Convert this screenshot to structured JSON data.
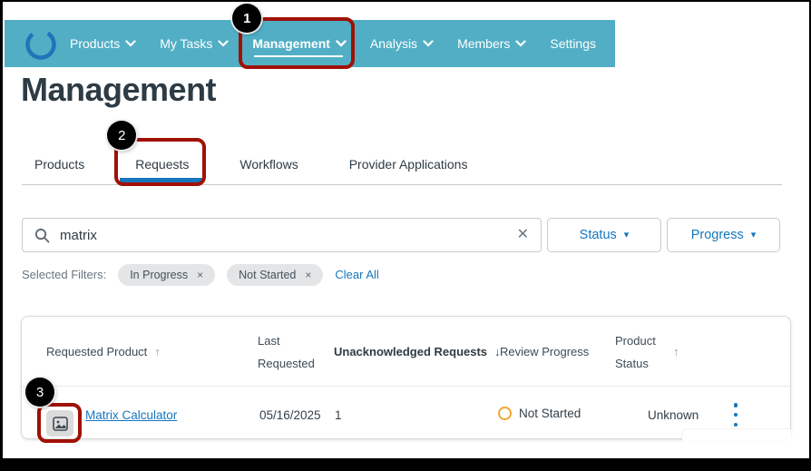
{
  "colors": {
    "navbar_teal": "#51AEC5",
    "accent_blue": "#1577BD",
    "heading_dark": "#2D3B45",
    "highlight_red": "#A01005",
    "status_amber": "#EFA92C",
    "callout_black": "#000000"
  },
  "navbar": {
    "items": [
      {
        "label": "Products",
        "chevron": true
      },
      {
        "label": "My Tasks",
        "chevron": true
      },
      {
        "label": "Management",
        "chevron": true,
        "active": true
      },
      {
        "label": "Analysis",
        "chevron": true
      },
      {
        "label": "Members",
        "chevron": true
      },
      {
        "label": "Settings",
        "chevron": false
      }
    ]
  },
  "page": {
    "title": "Management"
  },
  "tabs": {
    "items": [
      {
        "label": "Products"
      },
      {
        "label": "Requests",
        "active": true
      },
      {
        "label": "Workflows"
      },
      {
        "label": "Provider Applications"
      }
    ]
  },
  "search": {
    "value": "matrix",
    "clear_icon": "✕"
  },
  "filter_buttons": {
    "status_label": "Status",
    "progress_label": "Progress",
    "caret": "▾"
  },
  "selected_filters": {
    "label": "Selected Filters:",
    "chips": [
      {
        "label": "In Progress",
        "remove_icon": "×"
      },
      {
        "label": "Not Started",
        "remove_icon": "×"
      }
    ],
    "clear_all": "Clear All"
  },
  "table": {
    "columns": [
      {
        "label": "Requested Product",
        "sort_glyph": "↑"
      },
      {
        "label": "Last Requested",
        "sort_glyph": ""
      },
      {
        "label": "Unacknowledged Requests",
        "sort_glyph": "↓"
      },
      {
        "label": "Review Progress",
        "sort_glyph": ""
      },
      {
        "label": "Product Status",
        "sort_glyph": "↑"
      }
    ],
    "row": {
      "product": "Matrix Calculator",
      "last_requested": "05/16/2025",
      "unacknowledged": "1",
      "review_progress": "Not Started",
      "product_status": "Unknown"
    }
  },
  "callouts": {
    "one": "1",
    "two": "2",
    "three": "3"
  }
}
